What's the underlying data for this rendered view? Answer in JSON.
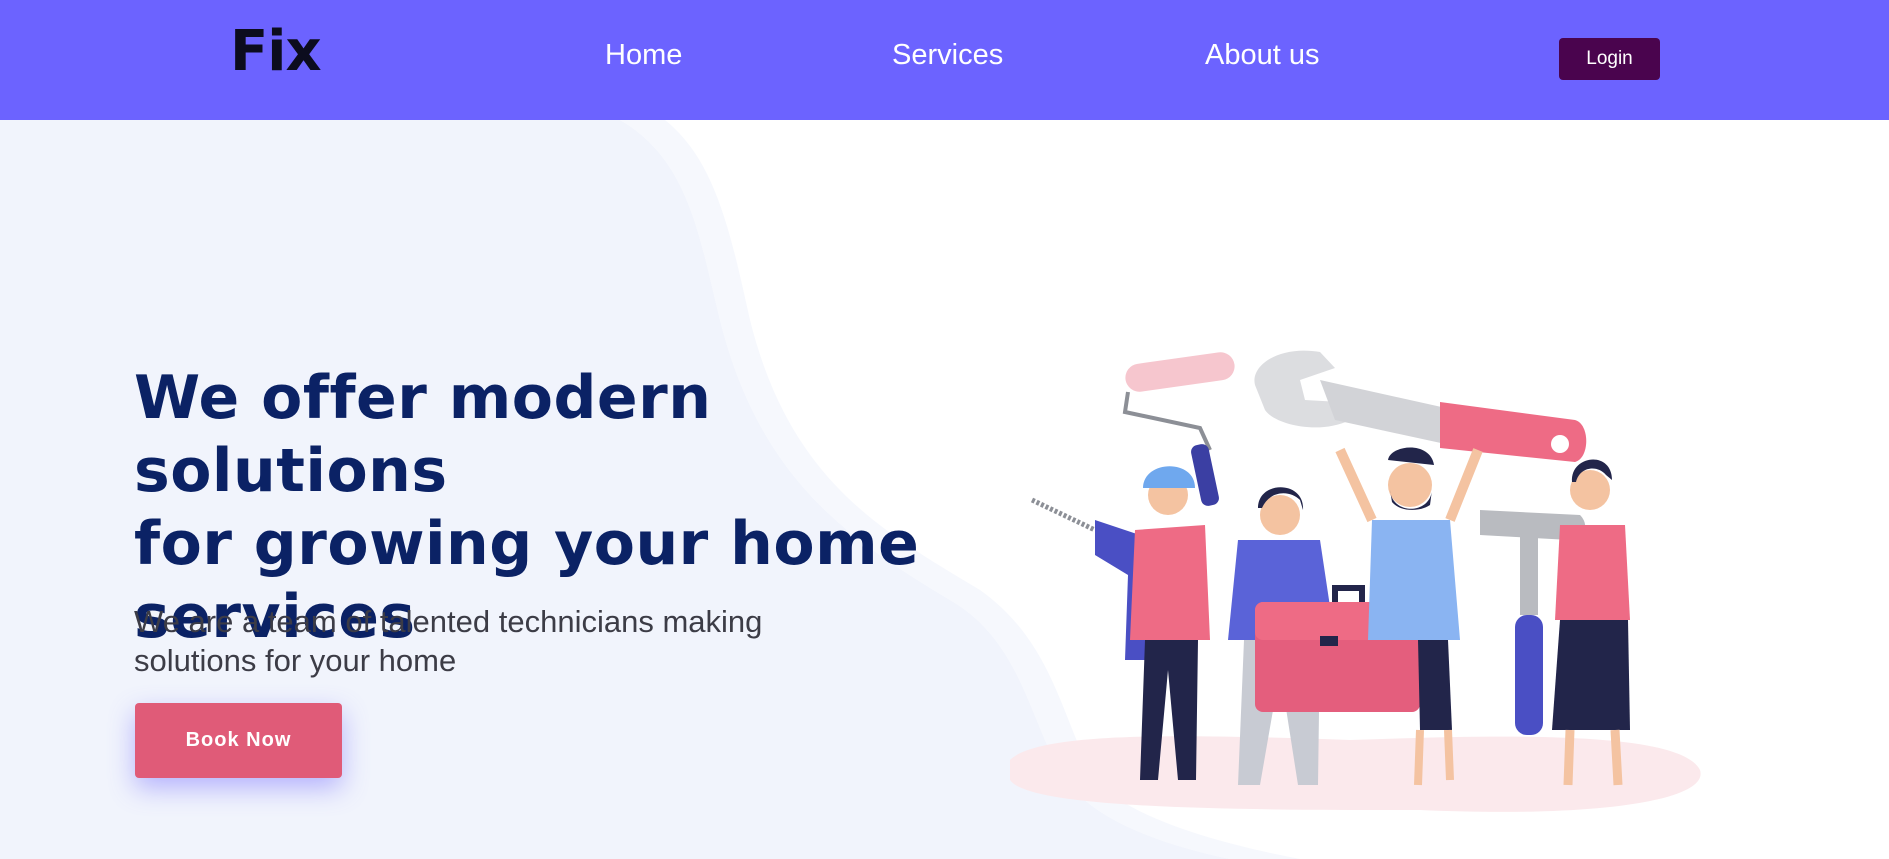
{
  "header": {
    "logo_text": "Fix",
    "nav": [
      {
        "label": "Home"
      },
      {
        "label": "Services"
      },
      {
        "label": "About us"
      }
    ],
    "login_label": "Login"
  },
  "hero": {
    "title_lines": [
      "We offer modern solutions",
      "for growing your home",
      "services"
    ],
    "subtitle_lines": [
      "We are a team of talented technicians making",
      "solutions for your home"
    ],
    "cta_label": "Book Now"
  },
  "colors": {
    "navbar": "#6c63ff",
    "login_button": "#4a044e",
    "title": "#0b2265",
    "cta": "#e05b78",
    "hero_background": "#f1f4fc"
  },
  "illustration": {
    "icon": "technicians-with-tools-illustration"
  }
}
